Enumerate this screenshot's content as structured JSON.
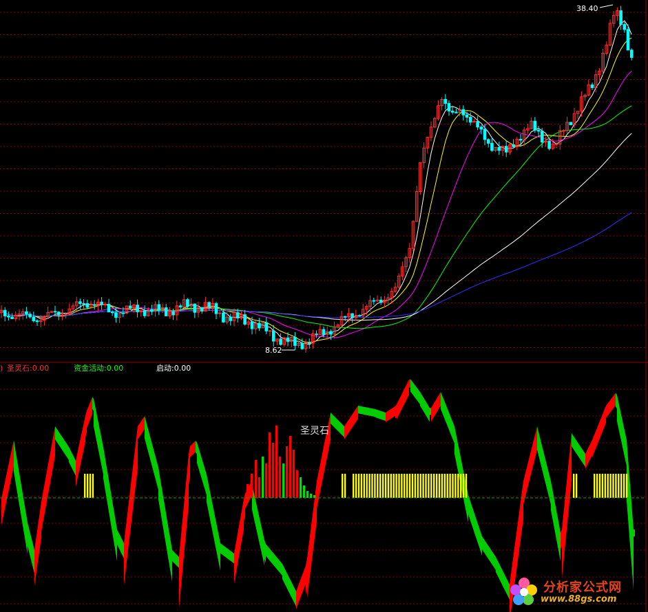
{
  "chart_data": [
    {
      "type": "candlestick",
      "price_high_label": "38.40",
      "price_low_label": "8.62",
      "price_high": 38.4,
      "price_low": 8.62,
      "moving_average_colors": [
        "#ffffff",
        "#ffff00",
        "#ff00ff",
        "#00ff00",
        "#ffffff",
        "#3030ff"
      ],
      "up_color": "#ff3030",
      "down_color": "#00ffff",
      "grid": true,
      "grid_color": "#8b0000"
    },
    {
      "type": "indicator",
      "legend": [
        {
          "label": "圣灵石:0.00",
          "color": "#ff3030"
        },
        {
          "label": "资金活动:0.00",
          "color": "#00ff00"
        },
        {
          "label": "启动:0.00",
          "color": "#ffffff"
        }
      ],
      "annotation": "圣灵石",
      "ribbon_up_color": "#ff0000",
      "ribbon_down_color": "#00cc00",
      "start_bar_color": "#ffff00",
      "baseline_color": "#00aa00",
      "grid": true
    }
  ],
  "watermark": {
    "site": "分析家公式网",
    "url": "www.88gs.com"
  }
}
